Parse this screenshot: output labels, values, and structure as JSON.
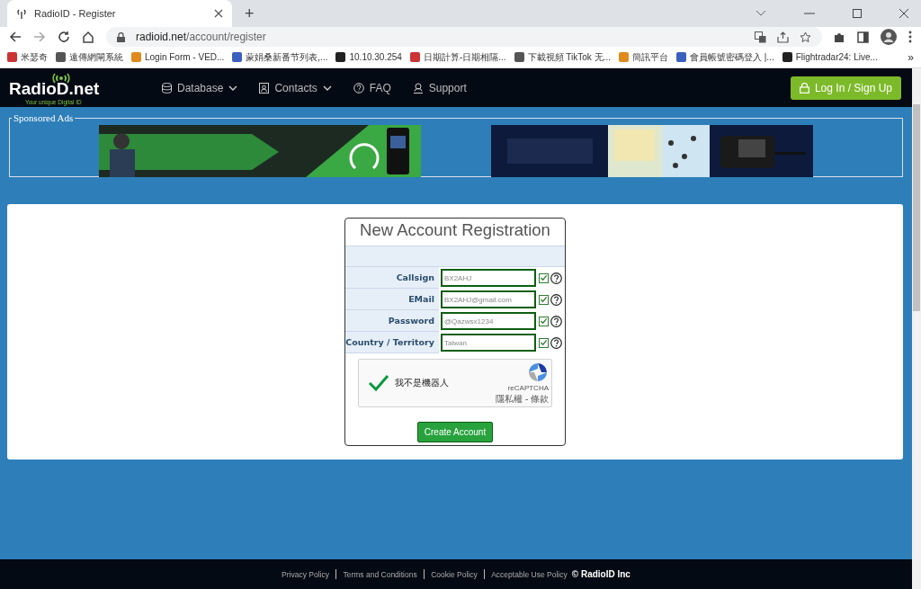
{
  "browser": {
    "tab_title": "RadioID - Register",
    "new_tab": "+",
    "url_host": "radioid.net",
    "url_path": "/account/register",
    "bookmarks": [
      {
        "label": "米瑟奇"
      },
      {
        "label": "遠傳網閘系統"
      },
      {
        "label": "Login Form - VED..."
      },
      {
        "label": "蒙娟桑新番节列表,..."
      },
      {
        "label": "10.10.30.254"
      },
      {
        "label": "日期計算-日期相隔..."
      },
      {
        "label": "下載視頻 TikTok 无..."
      },
      {
        "label": "簡訊平台"
      },
      {
        "label": "會員帳號密碼登入 |..."
      },
      {
        "label": "Flightradar24: Live..."
      }
    ],
    "more": "»"
  },
  "nav": {
    "logo": "RadioD.net",
    "tagline": "Your unique Digital ID",
    "items": [
      {
        "label": "Database",
        "dropdown": true
      },
      {
        "label": "Contacts",
        "dropdown": true
      },
      {
        "label": "FAQ",
        "dropdown": false
      },
      {
        "label": "Support",
        "dropdown": false
      }
    ],
    "login_button": "Log In / Sign Up"
  },
  "ads": {
    "legend": "Sponsored Ads"
  },
  "form": {
    "title": "New Account Registration",
    "fields": [
      {
        "label": "Callsign",
        "value": "BX2AHJ",
        "checked": true
      },
      {
        "label": "EMail",
        "value": "BX2AHJ@gmail.com",
        "checked": true
      },
      {
        "label": "Password",
        "value": "@Qazwsx1234",
        "checked": true
      },
      {
        "label": "Country / Territory",
        "value": "Taiwan",
        "checked": true
      }
    ],
    "captcha": {
      "checked": true,
      "label": "我不是機器人",
      "brand": "reCAPTCHA",
      "links": "隱私權 - 條款"
    },
    "submit": "Create Account"
  },
  "footer": {
    "links": [
      "Privacy Policy",
      "Terms and Conditions",
      "Cookie Policy",
      "Acceptable Use Policy"
    ],
    "copyright": "© RadioID Inc"
  }
}
